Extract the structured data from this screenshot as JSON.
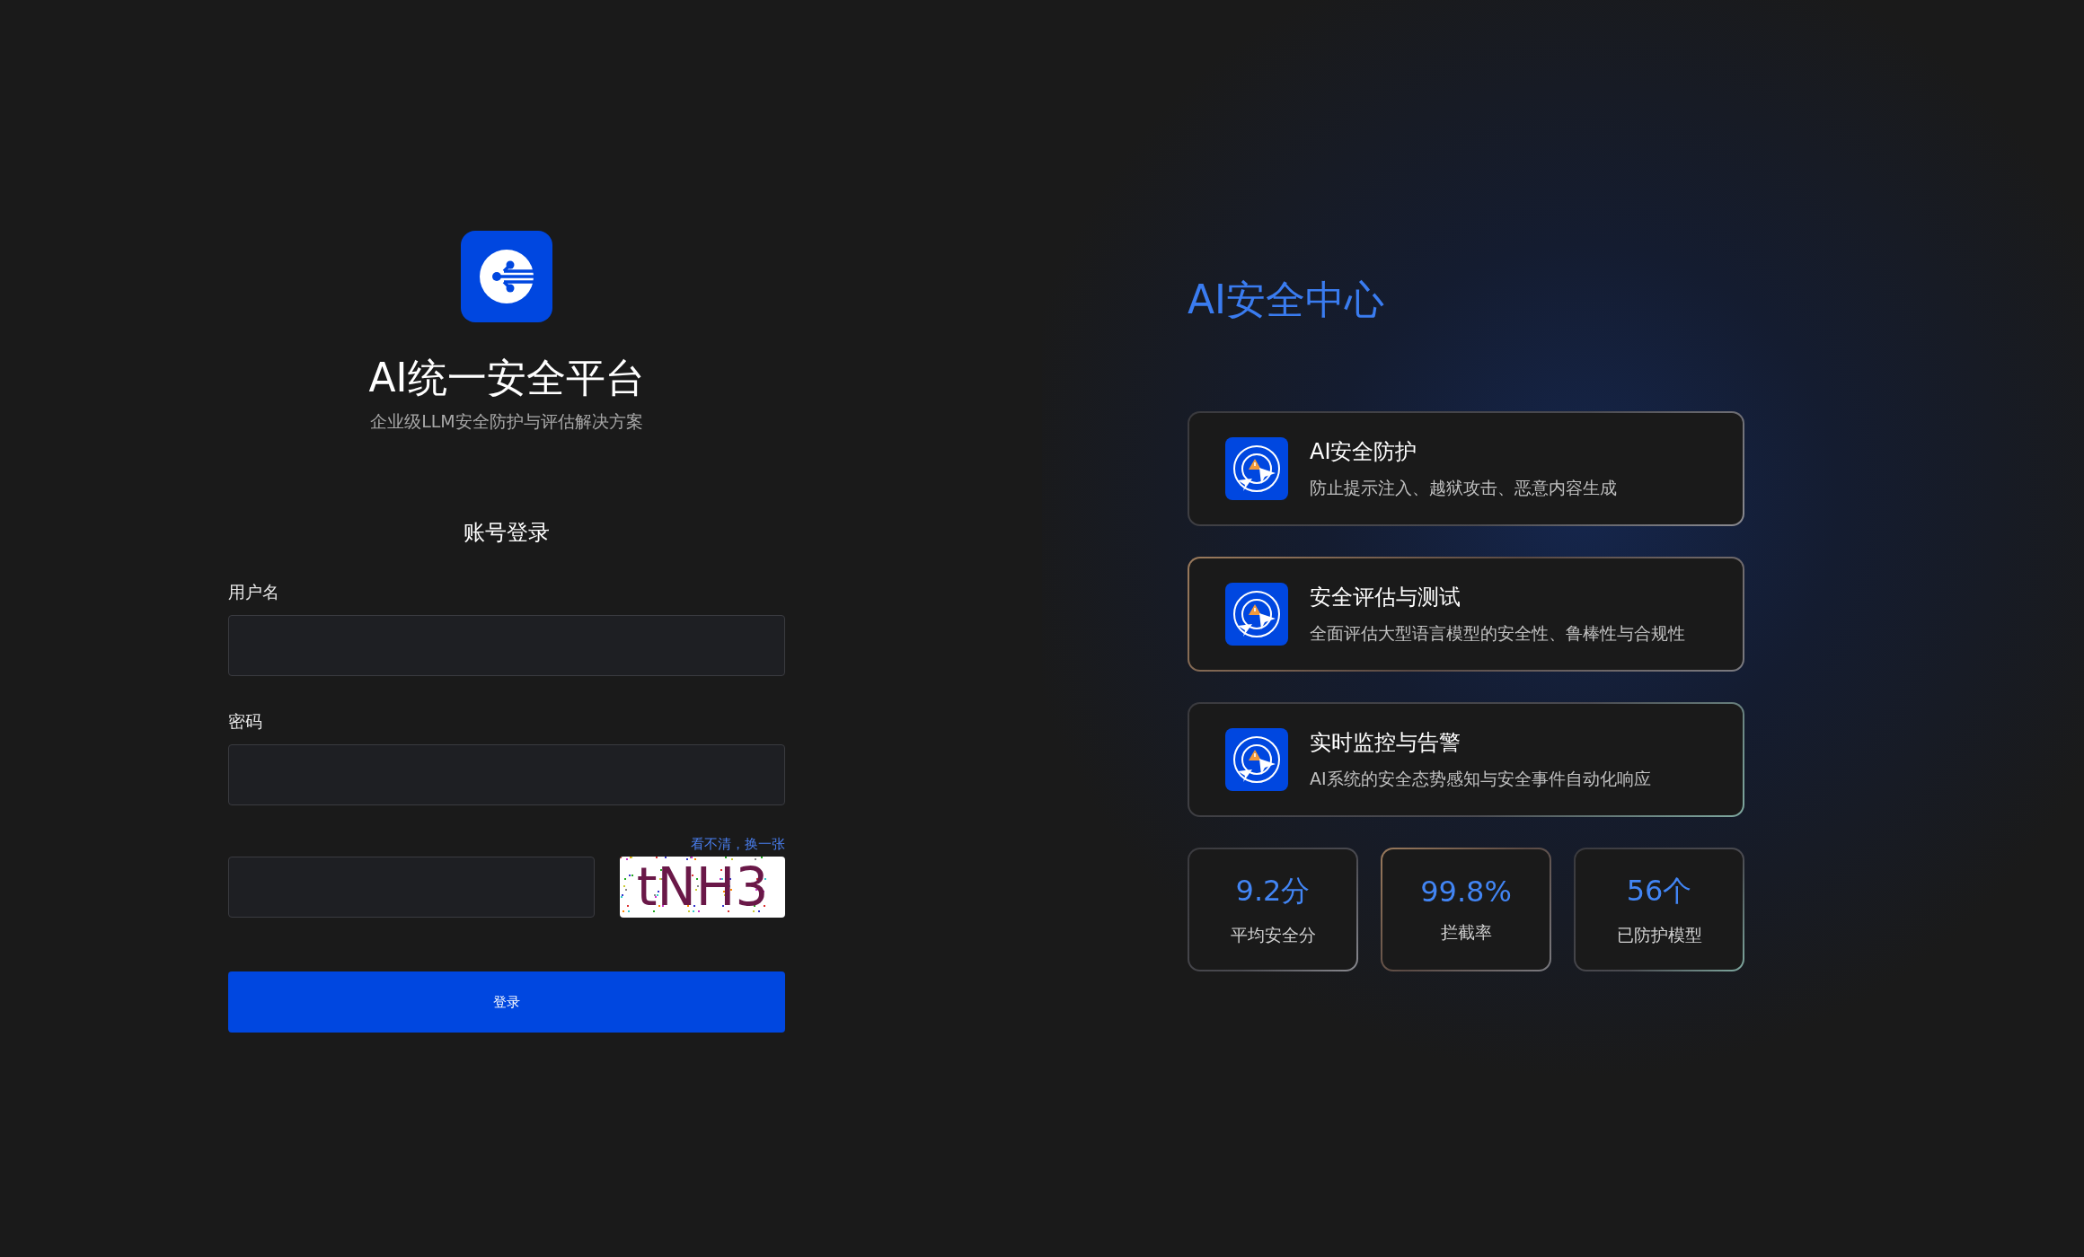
{
  "brand": {
    "title": "AI统一安全平台",
    "subtitle": "企业级LLM安全防护与评估解决方案"
  },
  "login": {
    "heading": "账号登录",
    "fields": [
      {
        "label": "用户名"
      },
      {
        "label": "密码"
      }
    ],
    "captcha": {
      "refresh_link": "看不清，换一张",
      "code": "tNH3"
    },
    "submit": "登录"
  },
  "showcase": {
    "title": "AI安全中心",
    "features": [
      {
        "title": "AI安全防护",
        "description": "防止提示注入、越狱攻击、恶意内容生成"
      },
      {
        "title": "安全评估与测试",
        "description": "全面评估大型语言模型的安全性、鲁棒性与合规性"
      },
      {
        "title": "实时监控与告警",
        "description": "AI系统的安全态势感知与安全事件自动化响应"
      }
    ],
    "stats": [
      {
        "value": "9.2分",
        "label": "平均安全分"
      },
      {
        "value": "99.8%",
        "label": "拦截率"
      },
      {
        "value": "56个",
        "label": "已防护模型"
      }
    ]
  }
}
